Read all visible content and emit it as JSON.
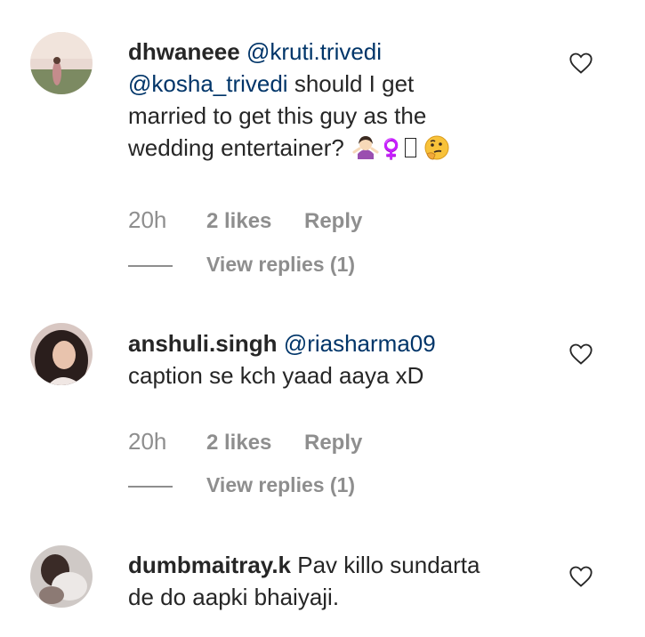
{
  "comments": [
    {
      "username": "dhwaneee",
      "mention1": "@kruti.trivedi",
      "mention2": "@kosha_trivedi",
      "text_line2": " should I get",
      "text_line3": "married to get this guy as the",
      "text_line4": "wedding entertainer? ",
      "glyphs": "♀️",
      "time": "20h",
      "likes": "2 likes",
      "reply": "Reply",
      "view_replies": "View replies (1)",
      "avatar_icon": "user-avatar"
    },
    {
      "username": "anshuli.singh",
      "mention1": "@riasharma09",
      "text_line2": "caption se kch yaad aaya xD",
      "time": "20h",
      "likes": "2 likes",
      "reply": "Reply",
      "view_replies": "View replies (1)",
      "avatar_icon": "user-avatar"
    },
    {
      "username": "dumbmaitray.k",
      "text_line1": "Pav killo sundarta",
      "text_line2": "de do aapki bhaiyaji.",
      "avatar_icon": "user-avatar"
    }
  ],
  "icons": {
    "like": "heart-outline-icon",
    "emoji1": "woman-shrugging-emoji",
    "emoji2": "thinking-face-emoji"
  },
  "colors": {
    "text": "#262626",
    "mention": "#003569",
    "meta": "#8e8e8e"
  }
}
